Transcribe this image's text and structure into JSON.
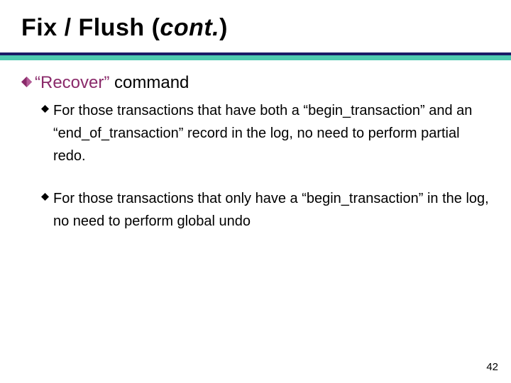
{
  "title": {
    "prefix": "Fix / Flush (",
    "italic": "cont.",
    "suffix": ")"
  },
  "section": {
    "quoted": "“Recover”",
    "rest": " command"
  },
  "bullets": [
    "For those transactions that have both a “begin_transaction” and an “end_of_transaction” record in the log, no need to perform partial redo.",
    "For those transactions that only have a “begin_transaction” in the log, no need to perform global undo"
  ],
  "page_number": "42",
  "colors": {
    "accent_mauve": "#8a2a6a",
    "rule_teal": "#4fc9b0",
    "rule_dark": "#1a1a66"
  }
}
